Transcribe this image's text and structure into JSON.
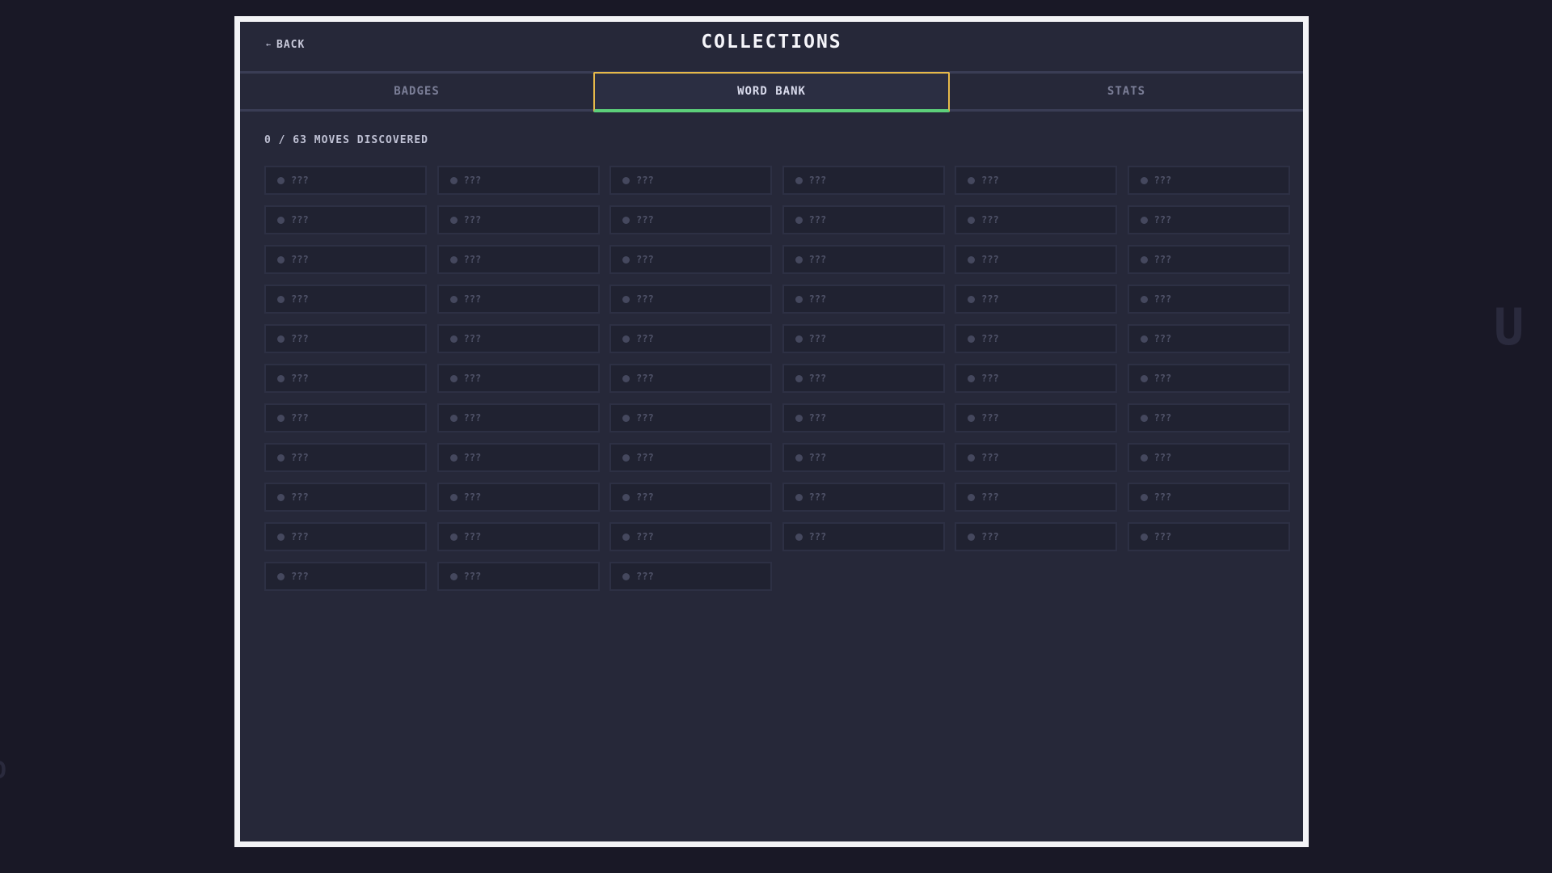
{
  "header": {
    "back_label": "BACK",
    "title": "COLLECTIONS"
  },
  "tabs": [
    {
      "label": "BADGES",
      "active": false
    },
    {
      "label": "WORD BANK",
      "active": true
    },
    {
      "label": "STATS",
      "active": false
    }
  ],
  "progress": {
    "discovered": 0,
    "total": 63,
    "text": "0 / 63 MOVES DISCOVERED"
  },
  "word_bank": {
    "columns": 6,
    "cells": [
      "???",
      "???",
      "???",
      "???",
      "???",
      "???",
      "???",
      "???",
      "???",
      "???",
      "???",
      "???",
      "???",
      "???",
      "???",
      "???",
      "???",
      "???",
      "???",
      "???",
      "???",
      "???",
      "???",
      "???",
      "???",
      "???",
      "???",
      "???",
      "???",
      "???",
      "???",
      "???",
      "???",
      "???",
      "???",
      "???",
      "???",
      "???",
      "???",
      "???",
      "???",
      "???",
      "???",
      "???",
      "???",
      "???",
      "???",
      "???",
      "???",
      "???",
      "???",
      "???",
      "???",
      "???",
      "???",
      "???",
      "???",
      "???",
      "???",
      "???",
      "???",
      "???",
      "???"
    ]
  },
  "background_glyphs": {
    "right": "U",
    "left": "D"
  },
  "colors": {
    "panel_border": "#f3f3f6",
    "active_tab_border": "#e6b94a",
    "active_tab_underline": "#5ccf7a"
  }
}
